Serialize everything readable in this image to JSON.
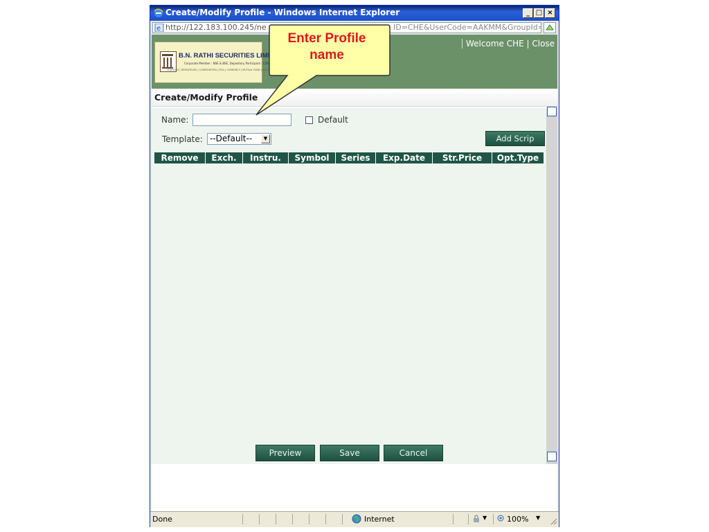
{
  "window": {
    "title": "Create/Modify Profile - Windows Internet Explorer",
    "url_start": "http://122.183.100.245/ne",
    "url_end": "ID=CHE&UserCode=AAKMM&GroupId=I"
  },
  "header": {
    "company_name": "B.N. RATHI SECURITIES LIMITED",
    "company_sub1": "Corporate Member : NSE & BSE, Depository Participant : CDSL",
    "company_sub2": "EQUITIES | DERIVATIVES | COMMODITIES | IPOs | CURRENCY | MUTUAL FUND | INSURANCE",
    "welcome": "Welcome CHE | Close"
  },
  "page": {
    "section_title": "Create/Modify Profile"
  },
  "form": {
    "name_label": "Name:",
    "name_value": "",
    "default_label": "Default",
    "template_label": "Template:",
    "template_value": "--Default--",
    "add_scrip": "Add Scrip"
  },
  "grid": {
    "columns": [
      "Remove",
      "Exch.",
      "Instru.",
      "Symbol",
      "Series",
      "Exp.Date",
      "Str.Price",
      "Opt.Type"
    ],
    "rows": []
  },
  "buttons": {
    "preview": "Preview",
    "save": "Save",
    "cancel": "Cancel"
  },
  "statusbar": {
    "status": "Done",
    "zone": "Internet",
    "zoom": "100%"
  },
  "callout": {
    "line1": "Enter Profile",
    "line2": "name"
  },
  "colors": {
    "header_green": "#6b9168",
    "grid_header": "#1f5547",
    "button_green": "#2d6655",
    "callout_fill": "#ffffa8",
    "callout_text": "#e0181c"
  }
}
